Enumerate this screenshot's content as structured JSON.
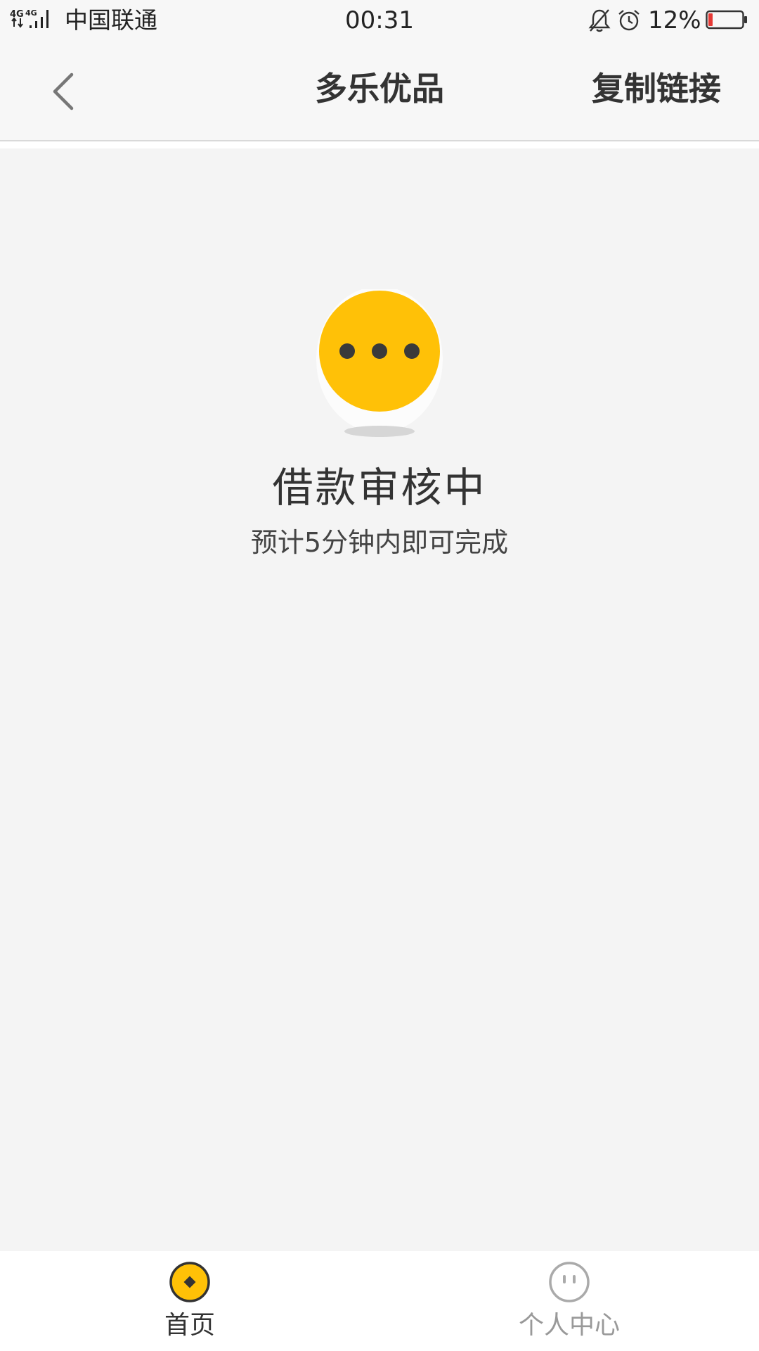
{
  "status_bar": {
    "network": "4G 4G",
    "carrier": "中国联通",
    "time": "00:31",
    "battery_percent": "12%",
    "icons": [
      "signal-icon",
      "bell-muted-icon",
      "alarm-icon",
      "battery-icon"
    ]
  },
  "nav": {
    "title": "多乐优品",
    "action_label": "复制链接",
    "back_icon": "back-chevron-icon"
  },
  "status": {
    "icon": "pending-dots-icon",
    "title": "借款审核中",
    "subtitle": "预计5分钟内即可完成"
  },
  "tab_bar": {
    "tabs": [
      {
        "label": "首页",
        "icon": "home-coin-icon",
        "active": true
      },
      {
        "label": "个人中心",
        "icon": "profile-face-icon",
        "active": false
      }
    ]
  },
  "colors": {
    "accent": "#FFC107",
    "background": "#F4F4F4",
    "nav_background": "#F7F7F7",
    "text_primary": "#333333",
    "text_muted": "#999999",
    "battery_low": "#E53935"
  }
}
